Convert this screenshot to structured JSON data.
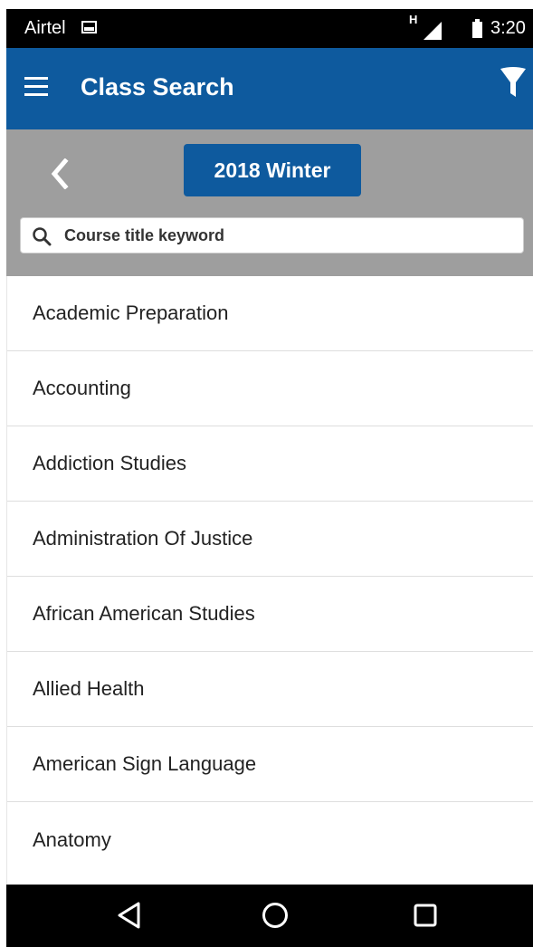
{
  "status_bar": {
    "carrier": "Airtel",
    "network": "H",
    "time": "3:20"
  },
  "app_bar": {
    "title": "Class Search",
    "menu_icon": "hamburger-menu-icon",
    "filter_icon": "filter-funnel-icon",
    "color": "#0e5a9e"
  },
  "term_bar": {
    "back_icon": "chevron-left-icon",
    "term_label": "2018 Winter",
    "color": "#9e9e9e"
  },
  "search": {
    "icon": "search-icon",
    "placeholder": "Course title keyword"
  },
  "subjects": [
    "Academic Preparation",
    "Accounting",
    "Addiction Studies",
    "Administration Of Justice",
    "African American Studies",
    "Allied Health",
    "American Sign Language",
    "Anatomy"
  ],
  "nav_bar": {
    "back_icon": "nav-back-triangle-icon",
    "home_icon": "nav-home-circle-icon",
    "recent_icon": "nav-recent-square-icon"
  }
}
